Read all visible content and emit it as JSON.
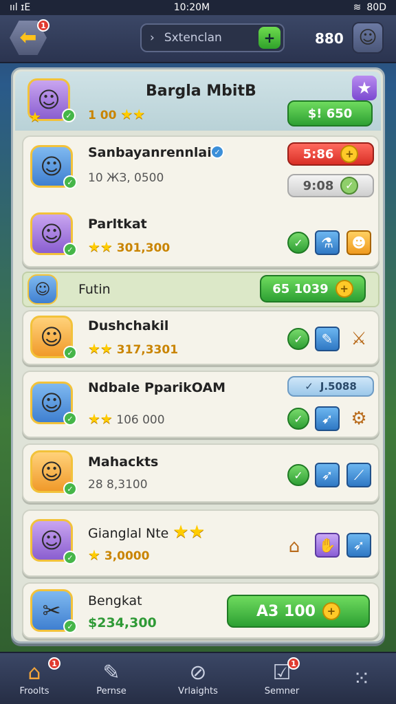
{
  "status_bar": {
    "left": "ııl ɪE",
    "time": "10:20M",
    "battery": "80D"
  },
  "topbar": {
    "back_badge": "1",
    "search_placeholder": "Sxtenclan",
    "search_go": "+",
    "coins": "880",
    "profile_icon": "character-avatar"
  },
  "header": {
    "title": "Bargla MbitB",
    "rating": "1 00",
    "price": "$! 650"
  },
  "rows": [
    {
      "name": "Sanbayanrennlait",
      "value": "10 ЖЗ, 0500",
      "pill_red": "5:86",
      "pill_grey": "9:08"
    },
    {
      "name": "Parltkat",
      "value": "301,300"
    },
    {
      "name": "Futin",
      "pill": "65 1039"
    },
    {
      "name": "Dushchakil",
      "value": "317,3301"
    },
    {
      "name": "Ndbale PparikOAM",
      "value": "106 000",
      "pill": "J.5088"
    },
    {
      "name": "Mahackts",
      "value": "28 8,3100"
    },
    {
      "name": "Gianglal Nte",
      "value": "3,0000"
    },
    {
      "name": "Bengkat",
      "value": "$234,300",
      "pill": "A3 100"
    }
  ],
  "nav": [
    {
      "label": "Froolts",
      "icon": "home-icon",
      "badge": "1"
    },
    {
      "label": "Pernse",
      "icon": "wrench-icon"
    },
    {
      "label": "Vrlaights",
      "icon": "circle-icon"
    },
    {
      "label": "Semner",
      "icon": "checkbox-icon",
      "badge": "1"
    },
    {
      "label": "",
      "icon": "grid-dots-icon"
    }
  ],
  "colors": {
    "accent_green": "#2da033",
    "accent_red": "#d92f26",
    "gold": "#ffc928",
    "frame": "#2b3450"
  }
}
